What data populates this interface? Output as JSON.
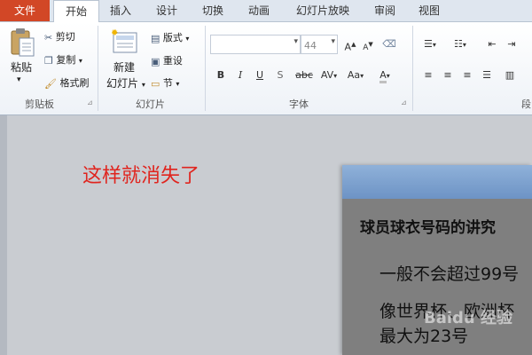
{
  "tabs": [
    "文件",
    "开始",
    "插入",
    "设计",
    "切换",
    "动画",
    "幻灯片放映",
    "审阅",
    "视图"
  ],
  "clipboard": {
    "paste": "粘贴",
    "cut": "剪切",
    "copy": "复制",
    "format_painter": "格式刷",
    "group_label": "剪贴板"
  },
  "slides": {
    "new_slide_line1": "新建",
    "new_slide_line2": "幻灯片",
    "layout": "版式",
    "reset": "重设",
    "section": "节",
    "group_label": "幻灯片"
  },
  "font": {
    "font_name": "",
    "font_size": "44",
    "group_label": "字体",
    "bold": "B",
    "italic": "I",
    "underline": "U",
    "shadow": "S",
    "strike": "abc",
    "spacing": "AV",
    "case": "Aa",
    "grow": "A",
    "shrink": "A"
  },
  "paragraph": {
    "group_label_partial": "段"
  },
  "caption": "这样就消失了",
  "slide": {
    "title": "球员球衣号码的讲究",
    "line1": "一般不会超过99号",
    "line2": "像世界杯、欧洲杯",
    "line3": "最大为23号"
  },
  "watermark": "Baidu 经验",
  "colors": {
    "file_tab": "#d24726",
    "caption": "#e0241e"
  }
}
